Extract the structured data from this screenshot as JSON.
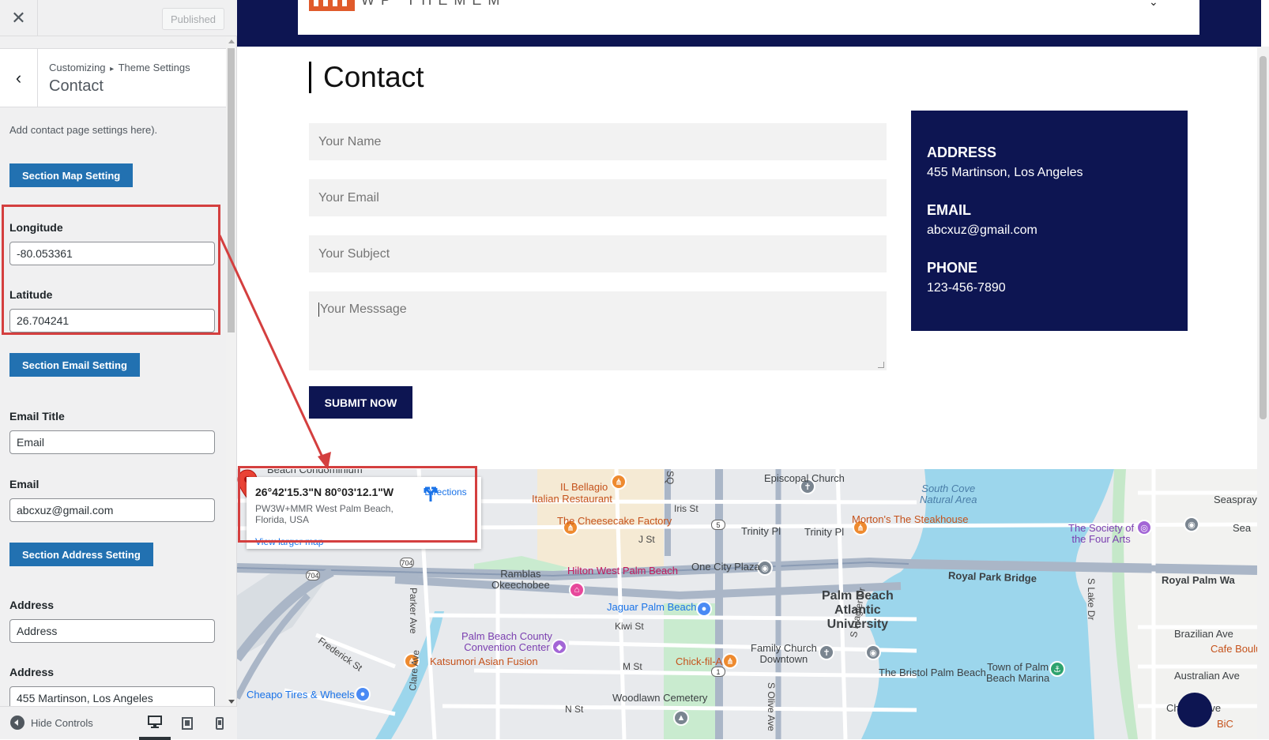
{
  "sidebar": {
    "close_glyph": "✕",
    "publish_label": "Published",
    "back_glyph": "‹",
    "breadcrumb_root": "Customizing",
    "breadcrumb_sep": "▸",
    "breadcrumb_parent": "Theme Settings",
    "section_title": "Contact",
    "description": "Add contact page settings here).",
    "map_section_button": "Section Map Setting",
    "longitude_label": "Longitude",
    "longitude_value": "-80.053361",
    "latitude_label": "Latitude",
    "latitude_value": "26.704241",
    "email_section_button": "Section Email Setting",
    "email_title_label": "Email Title",
    "email_title_value": "Email",
    "email_label": "Email",
    "email_value": "abcxuz@gmail.com",
    "address_section_button": "Section Address Setting",
    "address_title_label": "Address",
    "address_title_value": "Address",
    "address_label": "Address",
    "address_value": "455 Martinson, Los Angeles",
    "hide_controls_label": "Hide Controls",
    "devices": [
      "desktop-icon",
      "tablet-icon",
      "mobile-icon"
    ],
    "active_device": "desktop"
  },
  "site": {
    "logo_text": "WP THEMEM",
    "header_color": "#0d1552",
    "accent_color": "#e05a2b"
  },
  "page": {
    "title": "Contact",
    "form": {
      "name_placeholder": "Your Name",
      "email_placeholder": "Your Email",
      "subject_placeholder": "Your Subject",
      "message_placeholder": "Your Messsage",
      "submit_label": "SUBMIT NOW"
    },
    "info": {
      "address_heading": "ADDRESS",
      "address_value": "455 Martinson, Los Angeles",
      "email_heading": "EMAIL",
      "email_value": "abcxuz@gmail.com",
      "phone_heading": "PHONE",
      "phone_value": "123-456-7890"
    }
  },
  "map": {
    "coords": "26°42'15.3\"N 80°03'12.1\"W",
    "address": "PW3W+MMR West Palm Beach, Florida, USA",
    "directions_label": "Directions",
    "view_larger_label": "View larger map",
    "labels": {
      "beach_condominium": "Beach Condominium",
      "il_bellagio": "IL Bellagio",
      "italian_restaurant": "Italian Restaurant",
      "cheesecake": "The Cheesecake Factory",
      "iris_st": "Iris St",
      "episcopal": "Episcopal Church",
      "south_cove": "South Cove\nNatural Area",
      "seaspray": "Seaspray",
      "trinity_pl_1": "Trinity Pl",
      "trinity_pl_2": "Trinity Pl",
      "mortons": "Morton's The Steakhouse",
      "society": "The Society of\nthe Four Arts",
      "sea": "Sea",
      "j_st": "J St",
      "ramblas": "Ramblas\nOkeechobee",
      "hilton": "Hilton West Palm Beach",
      "one_city": "One City Plaza",
      "royal_park": "Royal Park Bridge",
      "royal_palm": "Royal Palm Wa",
      "parker_ave": "Parker Ave",
      "jaguar": "Jaguar Palm Beach",
      "pba": "Palm Beach\nAtlantic\nUniversity",
      "kiwi": "Kiwi St",
      "brazilian": "Brazilian Ave",
      "pbcc": "Palm Beach County\nConvention Center",
      "frederick": "Frederick St",
      "family_church": "Family Church\nDowntown",
      "flagler": "S Flagler Dr",
      "cafe": "Cafe Boulud",
      "katsumori": "Katsumori Asian Fusion",
      "chickfila": "Chick-fil-A",
      "bristol": "The Bristol Palm Beach",
      "marina": "Town of Palm\nBeach Marina",
      "australian": "Australian Ave",
      "m_st": "M St",
      "cheapo": "Cheapo Tires & Wheels",
      "woodlawn": "Woodlawn Cemetery",
      "n_st": "N St",
      "clare": "Clare Ave",
      "olive": "S Olive Ave",
      "chilean": "Chilean Ave",
      "s_lake": "S Lake Dr",
      "bic": "BiC",
      "sq": "SQ",
      "rd704a": "704",
      "rd704b": "704",
      "rd5": "5",
      "rd1": "1"
    }
  }
}
